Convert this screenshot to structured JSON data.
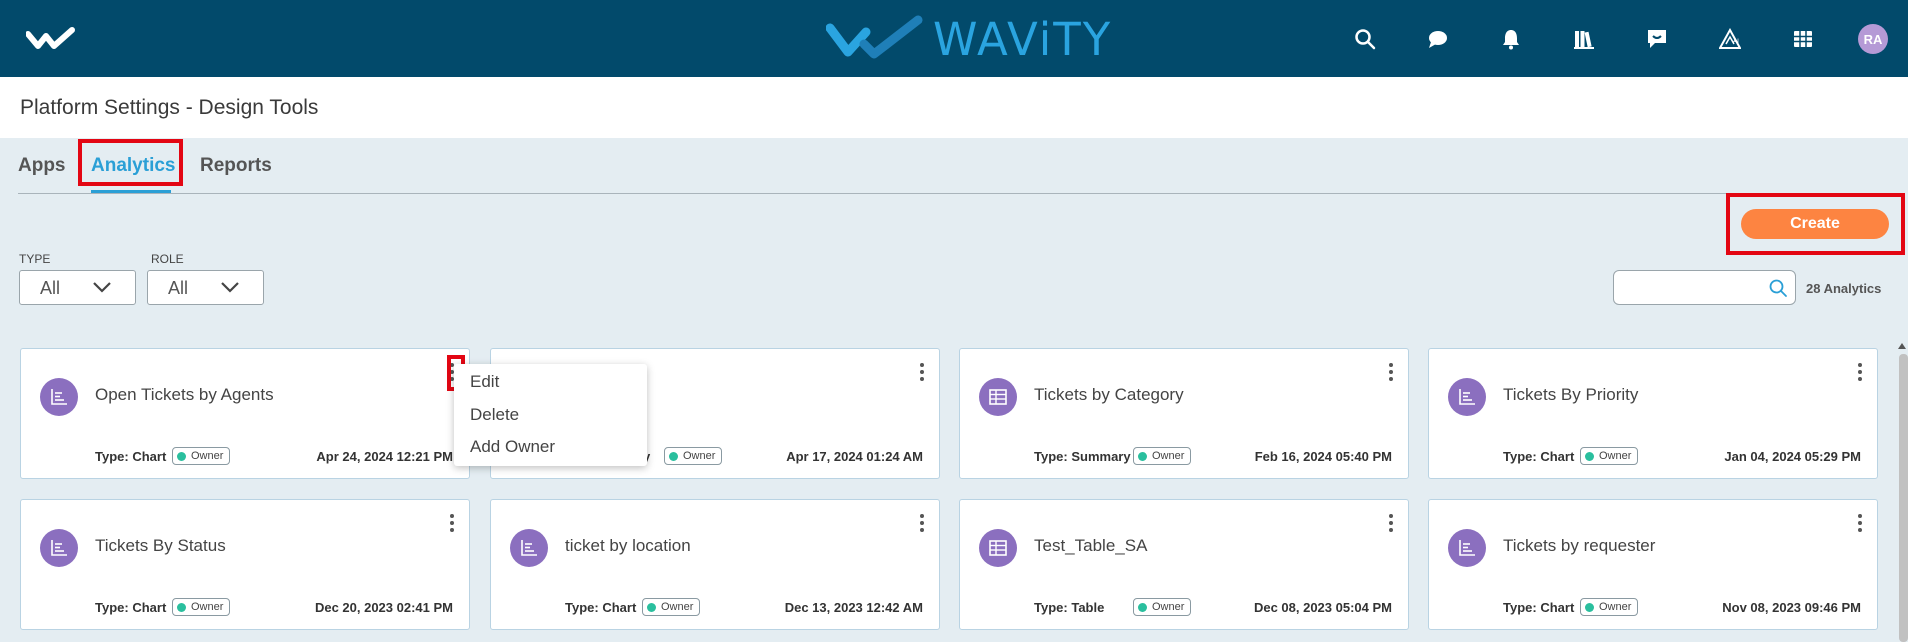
{
  "header": {
    "brand_name": "WAViTY",
    "avatar_initials": "RA",
    "icons": [
      "search-icon",
      "chat-icon",
      "bell-icon",
      "library-icon",
      "feedback-icon",
      "ai-icon",
      "grid-icon"
    ]
  },
  "page": {
    "title": "Platform Settings - Design Tools"
  },
  "tabs": [
    {
      "label": "Apps",
      "active": false
    },
    {
      "label": "Analytics",
      "active": true
    },
    {
      "label": "Reports",
      "active": false
    }
  ],
  "toolbar": {
    "create_label": "Create"
  },
  "filters": {
    "type_label": "TYPE",
    "type_value": "All",
    "role_label": "ROLE",
    "role_value": "All"
  },
  "search": {
    "placeholder": "",
    "count_text": "28 Analytics"
  },
  "colors": {
    "accent": "#2a9fd6",
    "header_bg": "#024a6b",
    "create": "#fd8441",
    "card_icon": "#8b6fbf",
    "owner_dot": "#2abf9e",
    "highlight": "#e30613"
  },
  "cards": [
    {
      "title": "Open Tickets by Agents",
      "type_label": "Type:",
      "type": "Chart",
      "owner": "Owner",
      "date": "Apr 24, 2024 12:21 PM",
      "icon": "chart-icon"
    },
    {
      "title": "",
      "type_label": "",
      "type": "y",
      "owner": "Owner",
      "date": "Apr 17, 2024 01:24 AM",
      "icon": "chart-icon"
    },
    {
      "title": "Tickets by Category",
      "type_label": "Type:",
      "type": "Summary",
      "owner": "Owner",
      "date": "Feb 16, 2024 05:40 PM",
      "icon": "table-icon"
    },
    {
      "title": "Tickets By Priority",
      "type_label": "Type:",
      "type": "Chart",
      "owner": "Owner",
      "date": "Jan 04, 2024 05:29 PM",
      "icon": "chart-icon"
    },
    {
      "title": "Tickets By Status",
      "type_label": "Type:",
      "type": "Chart",
      "owner": "Owner",
      "date": "Dec 20, 2023 02:41 PM",
      "icon": "chart-icon"
    },
    {
      "title": "ticket by location",
      "type_label": "Type:",
      "type": "Chart",
      "owner": "Owner",
      "date": "Dec 13, 2023 12:42 AM",
      "icon": "chart-icon"
    },
    {
      "title": "Test_Table_SA",
      "type_label": "Type:",
      "type": "Table",
      "owner": "Owner",
      "date": "Dec 08, 2023 05:04 PM",
      "icon": "table-icon"
    },
    {
      "title": "Tickets by requester",
      "type_label": "Type:",
      "type": "Chart",
      "owner": "Owner",
      "date": "Nov 08, 2023 09:46 PM",
      "icon": "chart-icon"
    }
  ],
  "context_menu": {
    "items": [
      "Edit",
      "Delete",
      "Add Owner"
    ]
  }
}
